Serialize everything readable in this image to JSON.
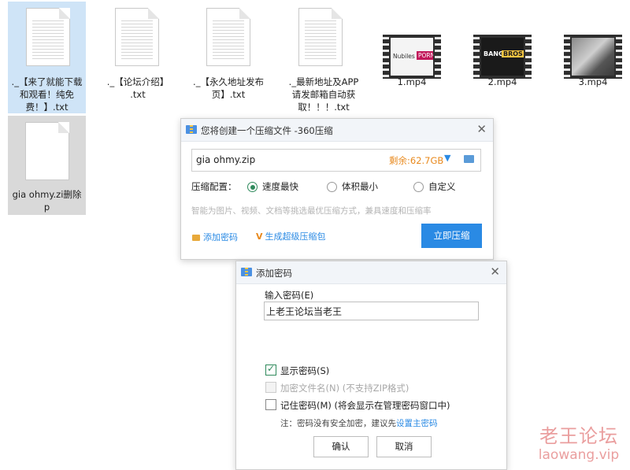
{
  "files": [
    {
      "name": "._【来了就能下载和观看！纯免费！】.txt",
      "lines": [
        "._【来了就能下载",
        "和观看！纯免",
        "费！】.txt"
      ],
      "selected": true
    },
    {
      "name": "._【论坛介绍】.txt",
      "lines": [
        "._【论坛介绍】",
        ".txt"
      ],
      "selected": false
    },
    {
      "name": "._【永久地址发布页】.txt",
      "lines": [
        "._【永久地址发布",
        "页】.txt"
      ],
      "selected": false
    },
    {
      "name": "._最新地址及APP请发邮箱自动获取！！！.txt",
      "lines": [
        "._最新地址及APP",
        "请发邮箱自动获",
        "取！！！.txt"
      ],
      "selected": false
    }
  ],
  "videos": [
    {
      "name": "1.mp4",
      "thumb_text_a": "Nubiles",
      "thumb_text_b": "PORN"
    },
    {
      "name": "2.mp4",
      "thumb_text_a": "BANG",
      "thumb_text_b": "BROS!"
    },
    {
      "name": "3.mp4"
    }
  ],
  "zipfile": {
    "lines": [
      "gia ohmy.zi删除",
      "p"
    ]
  },
  "compress_dialog": {
    "title": "您将创建一个压缩文件 -360压缩",
    "filename": "gia ohmy.zip",
    "remaining": "剩余:62.7GB",
    "config_label": "压缩配置：",
    "options": [
      "速度最快",
      "体积最小",
      "自定义"
    ],
    "selected_option": 0,
    "hint": "智能为图片、视频、文档等挑选最优压缩方式，兼具速度和压缩率",
    "add_password": "添加密码",
    "super_pack": "生成超级压缩包",
    "compress_now": "立即压缩"
  },
  "password_dialog": {
    "title": "添加密码",
    "input_label": "输入密码(E)",
    "password_value": "上老王论坛当老王",
    "show_password": "显示密码(S)",
    "show_password_checked": true,
    "encrypt_names": "加密文件名(N) (不支持ZIP格式)",
    "remember_password": "记住密码(M) (将会显示在管理密码窗口中)",
    "note_prefix": "注：密码没有安全加密，建议先",
    "note_link": "设置主密码",
    "ok": "确认",
    "cancel": "取消"
  },
  "watermark": {
    "cn": "老王论坛",
    "url": "laowang.vip"
  },
  "colors": {
    "accent": "#2a8ae4",
    "green": "#2f8a5c",
    "orange": "#e8891d",
    "watermark": "#d94f4f",
    "selection": "#cfe4f7"
  }
}
